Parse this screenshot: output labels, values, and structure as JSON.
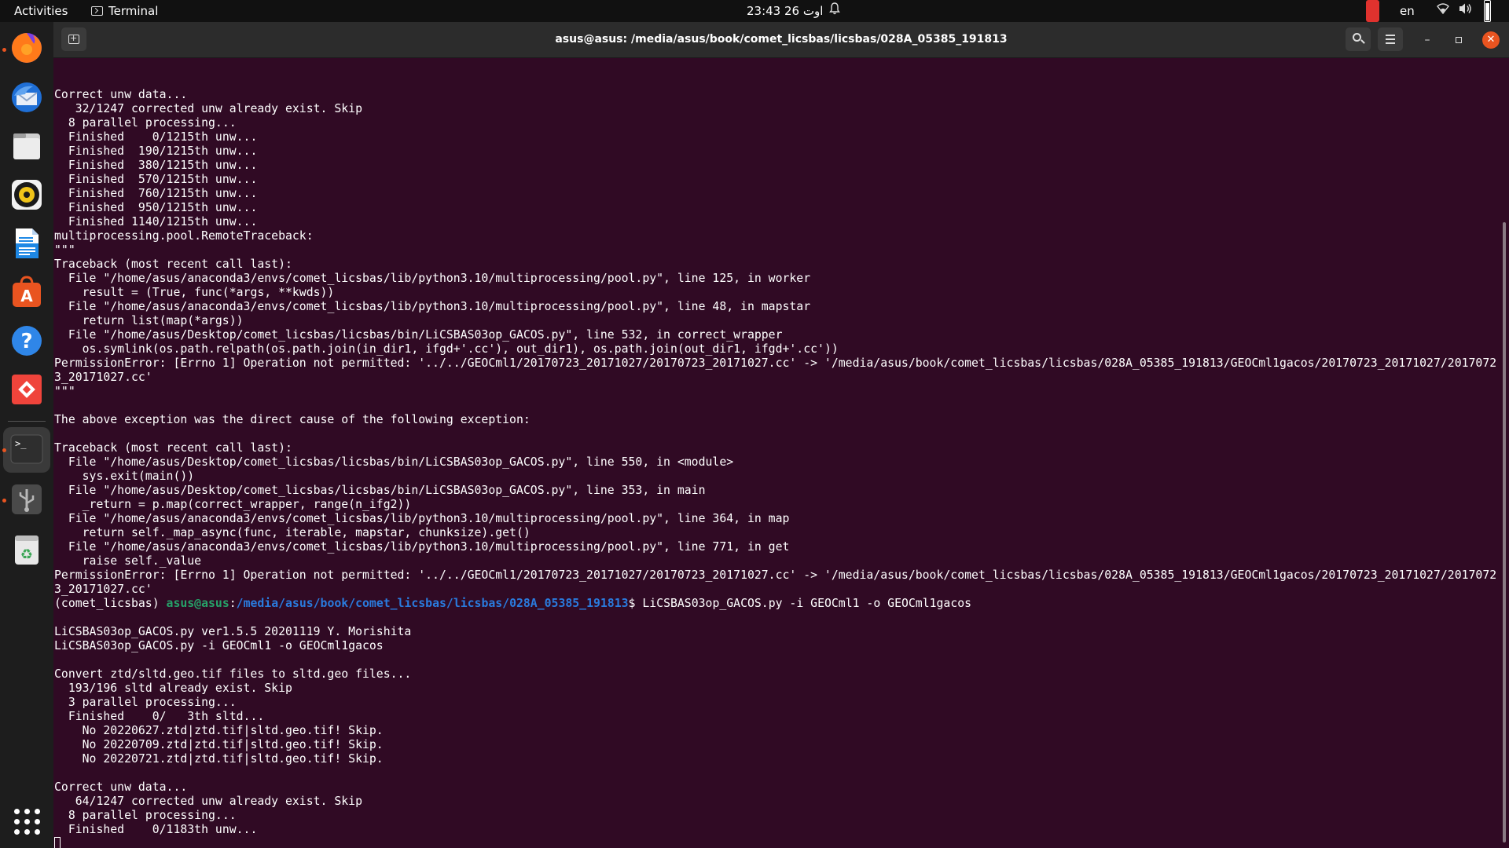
{
  "topbar": {
    "activities_label": "Activities",
    "app_menu_label": "Terminal",
    "clock": "23:43 اوت 26",
    "language": "en"
  },
  "dock": {
    "items": [
      {
        "name": "firefox-icon",
        "color": "#e66000"
      },
      {
        "name": "thunderbird-icon",
        "color": "#1f6fd6"
      },
      {
        "name": "files-icon",
        "color": "#d9d9d9"
      },
      {
        "name": "rhythmbox-icon",
        "color": "#f0c419"
      },
      {
        "name": "libreoffice-writer-icon",
        "color": "#1e88e5"
      },
      {
        "name": "ubuntu-software-icon",
        "color": "#e95420"
      },
      {
        "name": "help-icon",
        "color": "#2f86e8"
      },
      {
        "name": "anydesk-icon",
        "color": "#ef443b"
      },
      {
        "name": "terminal-icon",
        "color": "#2e2e2e"
      },
      {
        "name": "usb-drive-icon",
        "color": "#8a8a8a"
      },
      {
        "name": "trash-icon",
        "color": "#3aa655"
      },
      {
        "name": "show-applications-icon",
        "color": "#ffffff"
      }
    ]
  },
  "window": {
    "title": "asus@asus: /media/asus/book/comet_licsbas/licsbas/028A_05385_191813"
  },
  "terminal": {
    "lines_before_prompt": [
      "",
      "Correct unw data...",
      "   32/1247 corrected unw already exist. Skip",
      "  8 parallel processing...",
      "  Finished    0/1215th unw...",
      "  Finished  190/1215th unw...",
      "  Finished  380/1215th unw...",
      "  Finished  570/1215th unw...",
      "  Finished  760/1215th unw...",
      "  Finished  950/1215th unw...",
      "  Finished 1140/1215th unw...",
      "multiprocessing.pool.RemoteTraceback:",
      "\"\"\"",
      "Traceback (most recent call last):",
      "  File \"/home/asus/anaconda3/envs/comet_licsbas/lib/python3.10/multiprocessing/pool.py\", line 125, in worker",
      "    result = (True, func(*args, **kwds))",
      "  File \"/home/asus/anaconda3/envs/comet_licsbas/lib/python3.10/multiprocessing/pool.py\", line 48, in mapstar",
      "    return list(map(*args))",
      "  File \"/home/asus/Desktop/comet_licsbas/licsbas/bin/LiCSBAS03op_GACOS.py\", line 532, in correct_wrapper",
      "    os.symlink(os.path.relpath(os.path.join(in_dir1, ifgd+'.cc'), out_dir1), os.path.join(out_dir1, ifgd+'.cc'))",
      "PermissionError: [Errno 1] Operation not permitted: '../../GEOCml1/20170723_20171027/20170723_20171027.cc' -> '/media/asus/book/comet_licsbas/licsbas/028A_05385_191813/GEOCml1gacos/20170723_20171027/20170723_20171027.cc'",
      "\"\"\"",
      "",
      "The above exception was the direct cause of the following exception:",
      "",
      "Traceback (most recent call last):",
      "  File \"/home/asus/Desktop/comet_licsbas/licsbas/bin/LiCSBAS03op_GACOS.py\", line 550, in <module>",
      "    sys.exit(main())",
      "  File \"/home/asus/Desktop/comet_licsbas/licsbas/bin/LiCSBAS03op_GACOS.py\", line 353, in main",
      "    _return = p.map(correct_wrapper, range(n_ifg2))",
      "  File \"/home/asus/anaconda3/envs/comet_licsbas/lib/python3.10/multiprocessing/pool.py\", line 364, in map",
      "    return self._map_async(func, iterable, mapstar, chunksize).get()",
      "  File \"/home/asus/anaconda3/envs/comet_licsbas/lib/python3.10/multiprocessing/pool.py\", line 771, in get",
      "    raise self._value",
      "PermissionError: [Errno 1] Operation not permitted: '../../GEOCml1/20170723_20171027/20170723_20171027.cc' -> '/media/asus/book/comet_licsbas/licsbas/028A_05385_191813/GEOCml1gacos/20170723_20171027/20170723_20171027.cc'"
    ],
    "prompt": {
      "env": "(comet_licsbas) ",
      "user_host": "asus@asus",
      "colon": ":",
      "path": "/media/asus/book/comet_licsbas/licsbas/028A_05385_191813",
      "dollar": "$ ",
      "command": "LiCSBAS03op_GACOS.py -i GEOCml1 -o GEOCml1gacos"
    },
    "lines_after_prompt": [
      "",
      "LiCSBAS03op_GACOS.py ver1.5.5 20201119 Y. Morishita",
      "LiCSBAS03op_GACOS.py -i GEOCml1 -o GEOCml1gacos",
      "",
      "Convert ztd/sltd.geo.tif files to sltd.geo files...",
      "  193/196 sltd already exist. Skip",
      "  3 parallel processing...",
      "  Finished    0/   3th sltd...",
      "    No 20220627.ztd|ztd.tif|sltd.geo.tif! Skip.",
      "    No 20220709.ztd|ztd.tif|sltd.geo.tif! Skip.",
      "    No 20220721.ztd|ztd.tif|sltd.geo.tif! Skip.",
      "",
      "Correct unw data...",
      "   64/1247 corrected unw already exist. Skip",
      "  8 parallel processing...",
      "  Finished    0/1183th unw..."
    ]
  },
  "colors": {
    "terminal_bg": "#300a24",
    "prompt_user": "#26a269",
    "prompt_path": "#2a7bde",
    "accent": "#e95420"
  }
}
